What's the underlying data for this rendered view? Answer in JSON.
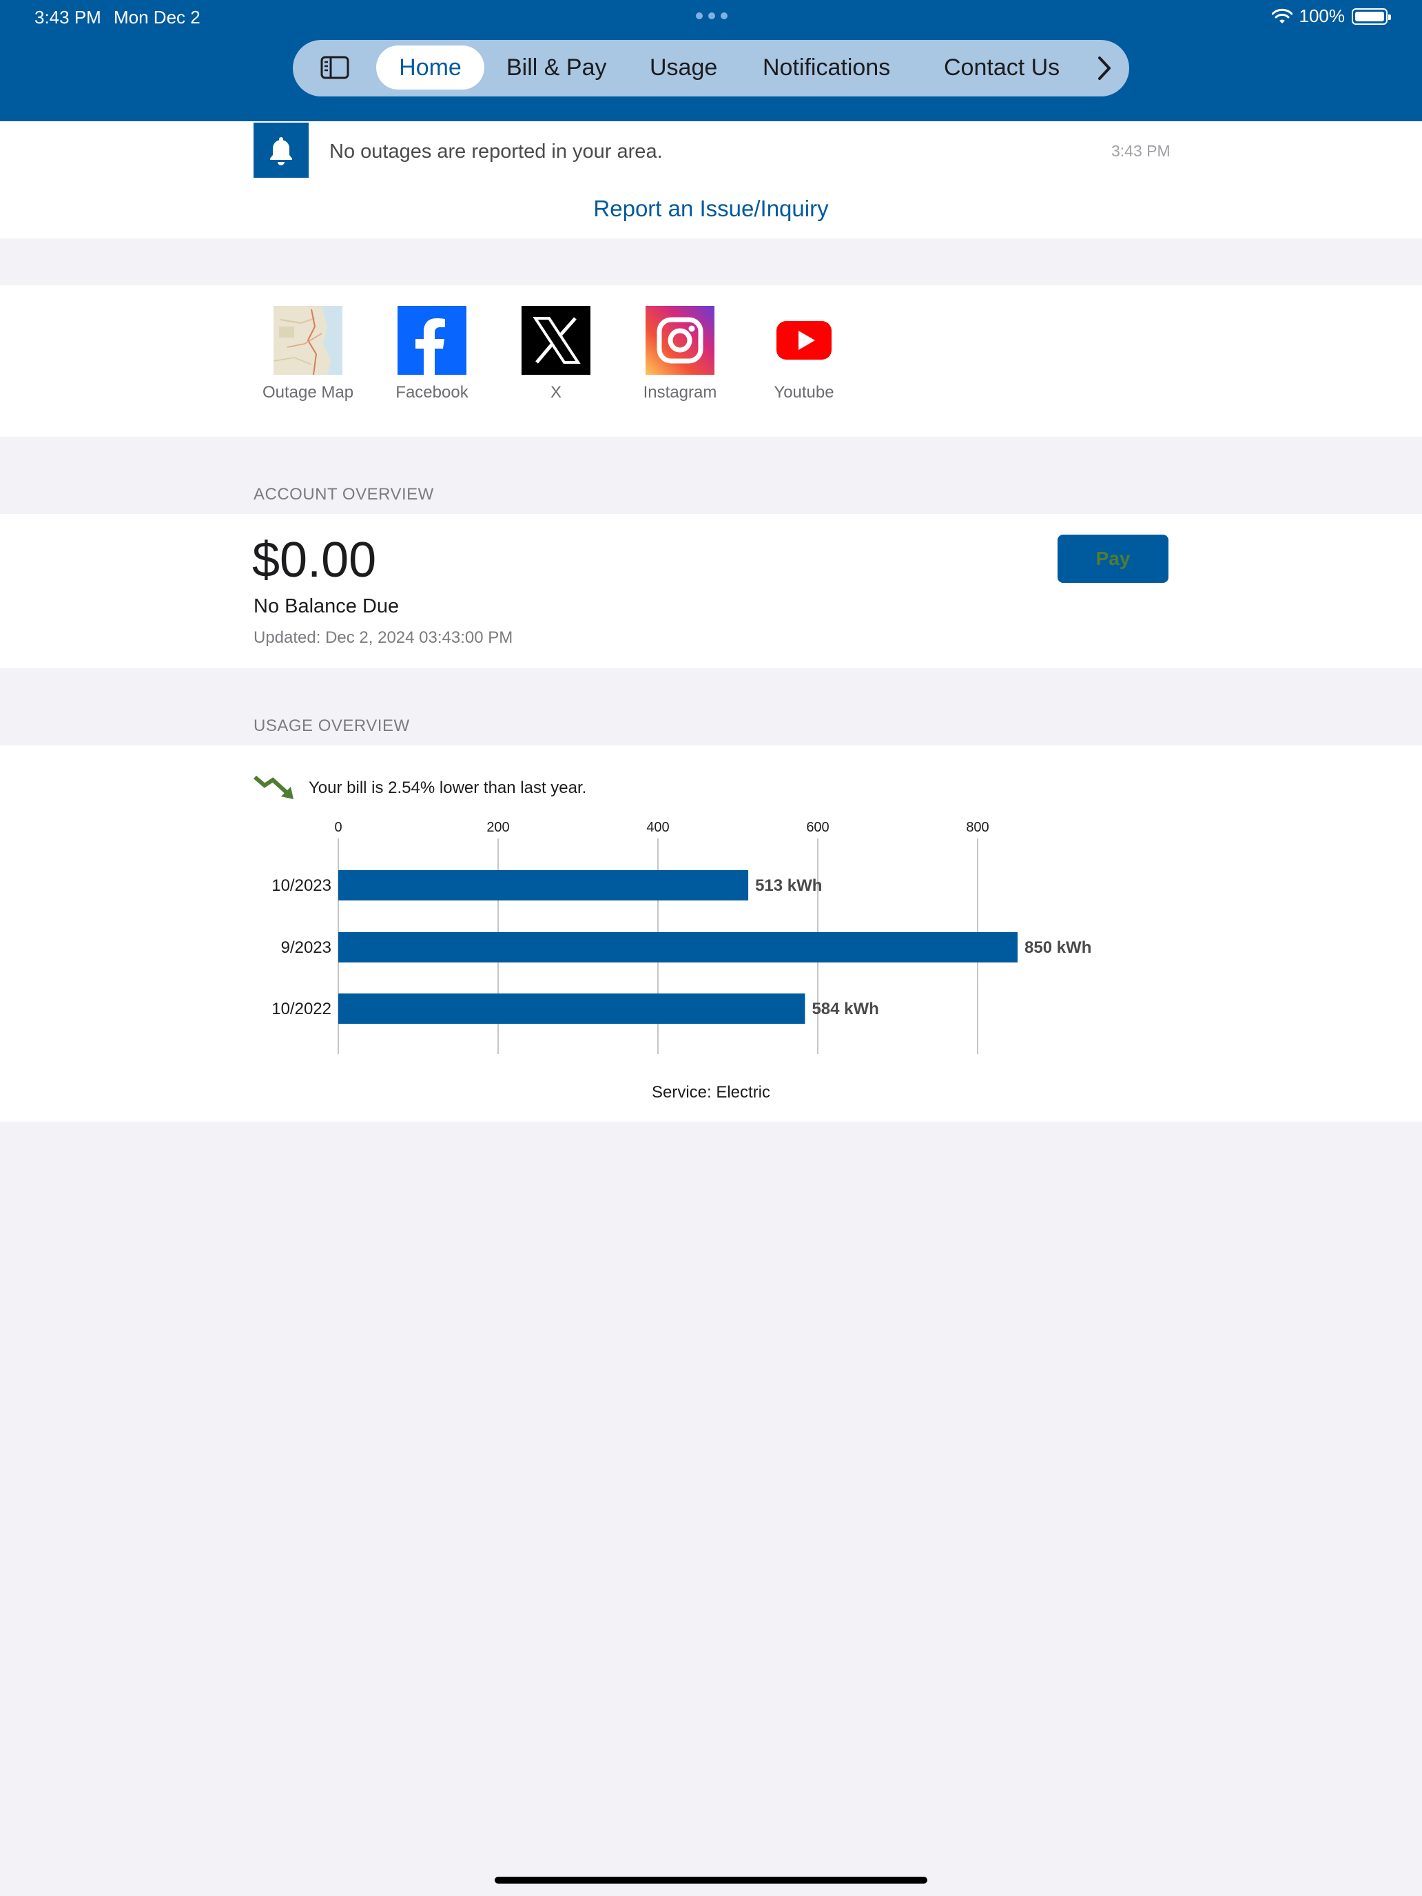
{
  "status_bar": {
    "time": "3:43 PM",
    "date": "Mon Dec 2",
    "battery": "100%"
  },
  "nav": {
    "tabs": [
      {
        "label": "Home",
        "active": true
      },
      {
        "label": "Bill & Pay",
        "active": false
      },
      {
        "label": "Usage",
        "active": false
      },
      {
        "label": "Notifications",
        "active": false
      },
      {
        "label": "Contact Us",
        "active": false
      }
    ],
    "icons": {
      "sidebar": "sidebar-toggle-icon",
      "next": "chevron-right-icon"
    }
  },
  "outage": {
    "message": "No outages are reported in your area.",
    "time": "3:43 PM",
    "report_link": "Report an Issue/Inquiry",
    "icon": "bell-icon"
  },
  "social": {
    "items": [
      {
        "label": "Outage Map",
        "icon": "outage-map-icon"
      },
      {
        "label": "Facebook",
        "icon": "facebook-icon"
      },
      {
        "label": "X",
        "icon": "x-icon"
      },
      {
        "label": "Instagram",
        "icon": "instagram-icon"
      },
      {
        "label": "Youtube",
        "icon": "youtube-icon"
      }
    ]
  },
  "account": {
    "section_title": "ACCOUNT OVERVIEW",
    "amount": "$0.00",
    "balance_note": "No Balance Due",
    "updated": "Updated: Dec 2, 2024 03:43:00 PM",
    "pay_label": "Pay"
  },
  "usage": {
    "section_title": "USAGE OVERVIEW",
    "trend_text": "Your bill is 2.54% lower than last year.",
    "service": "Service: Electric"
  },
  "colors": {
    "brand": "#005a9e",
    "nav_pill": "#a9c6e2",
    "trend_green": "#4f7d32",
    "background": "#f2f2f7"
  },
  "chart_data": {
    "type": "bar",
    "orientation": "horizontal",
    "categories": [
      "10/2023",
      "9/2023",
      "10/2022"
    ],
    "values": [
      513,
      850,
      584
    ],
    "value_labels": [
      "513 kWh",
      "850 kWh",
      "584 kWh"
    ],
    "x_ticks": [
      0,
      200,
      400,
      600,
      800
    ],
    "xlim": [
      0,
      800
    ],
    "grid": true,
    "bar_color": "#005a9e"
  }
}
